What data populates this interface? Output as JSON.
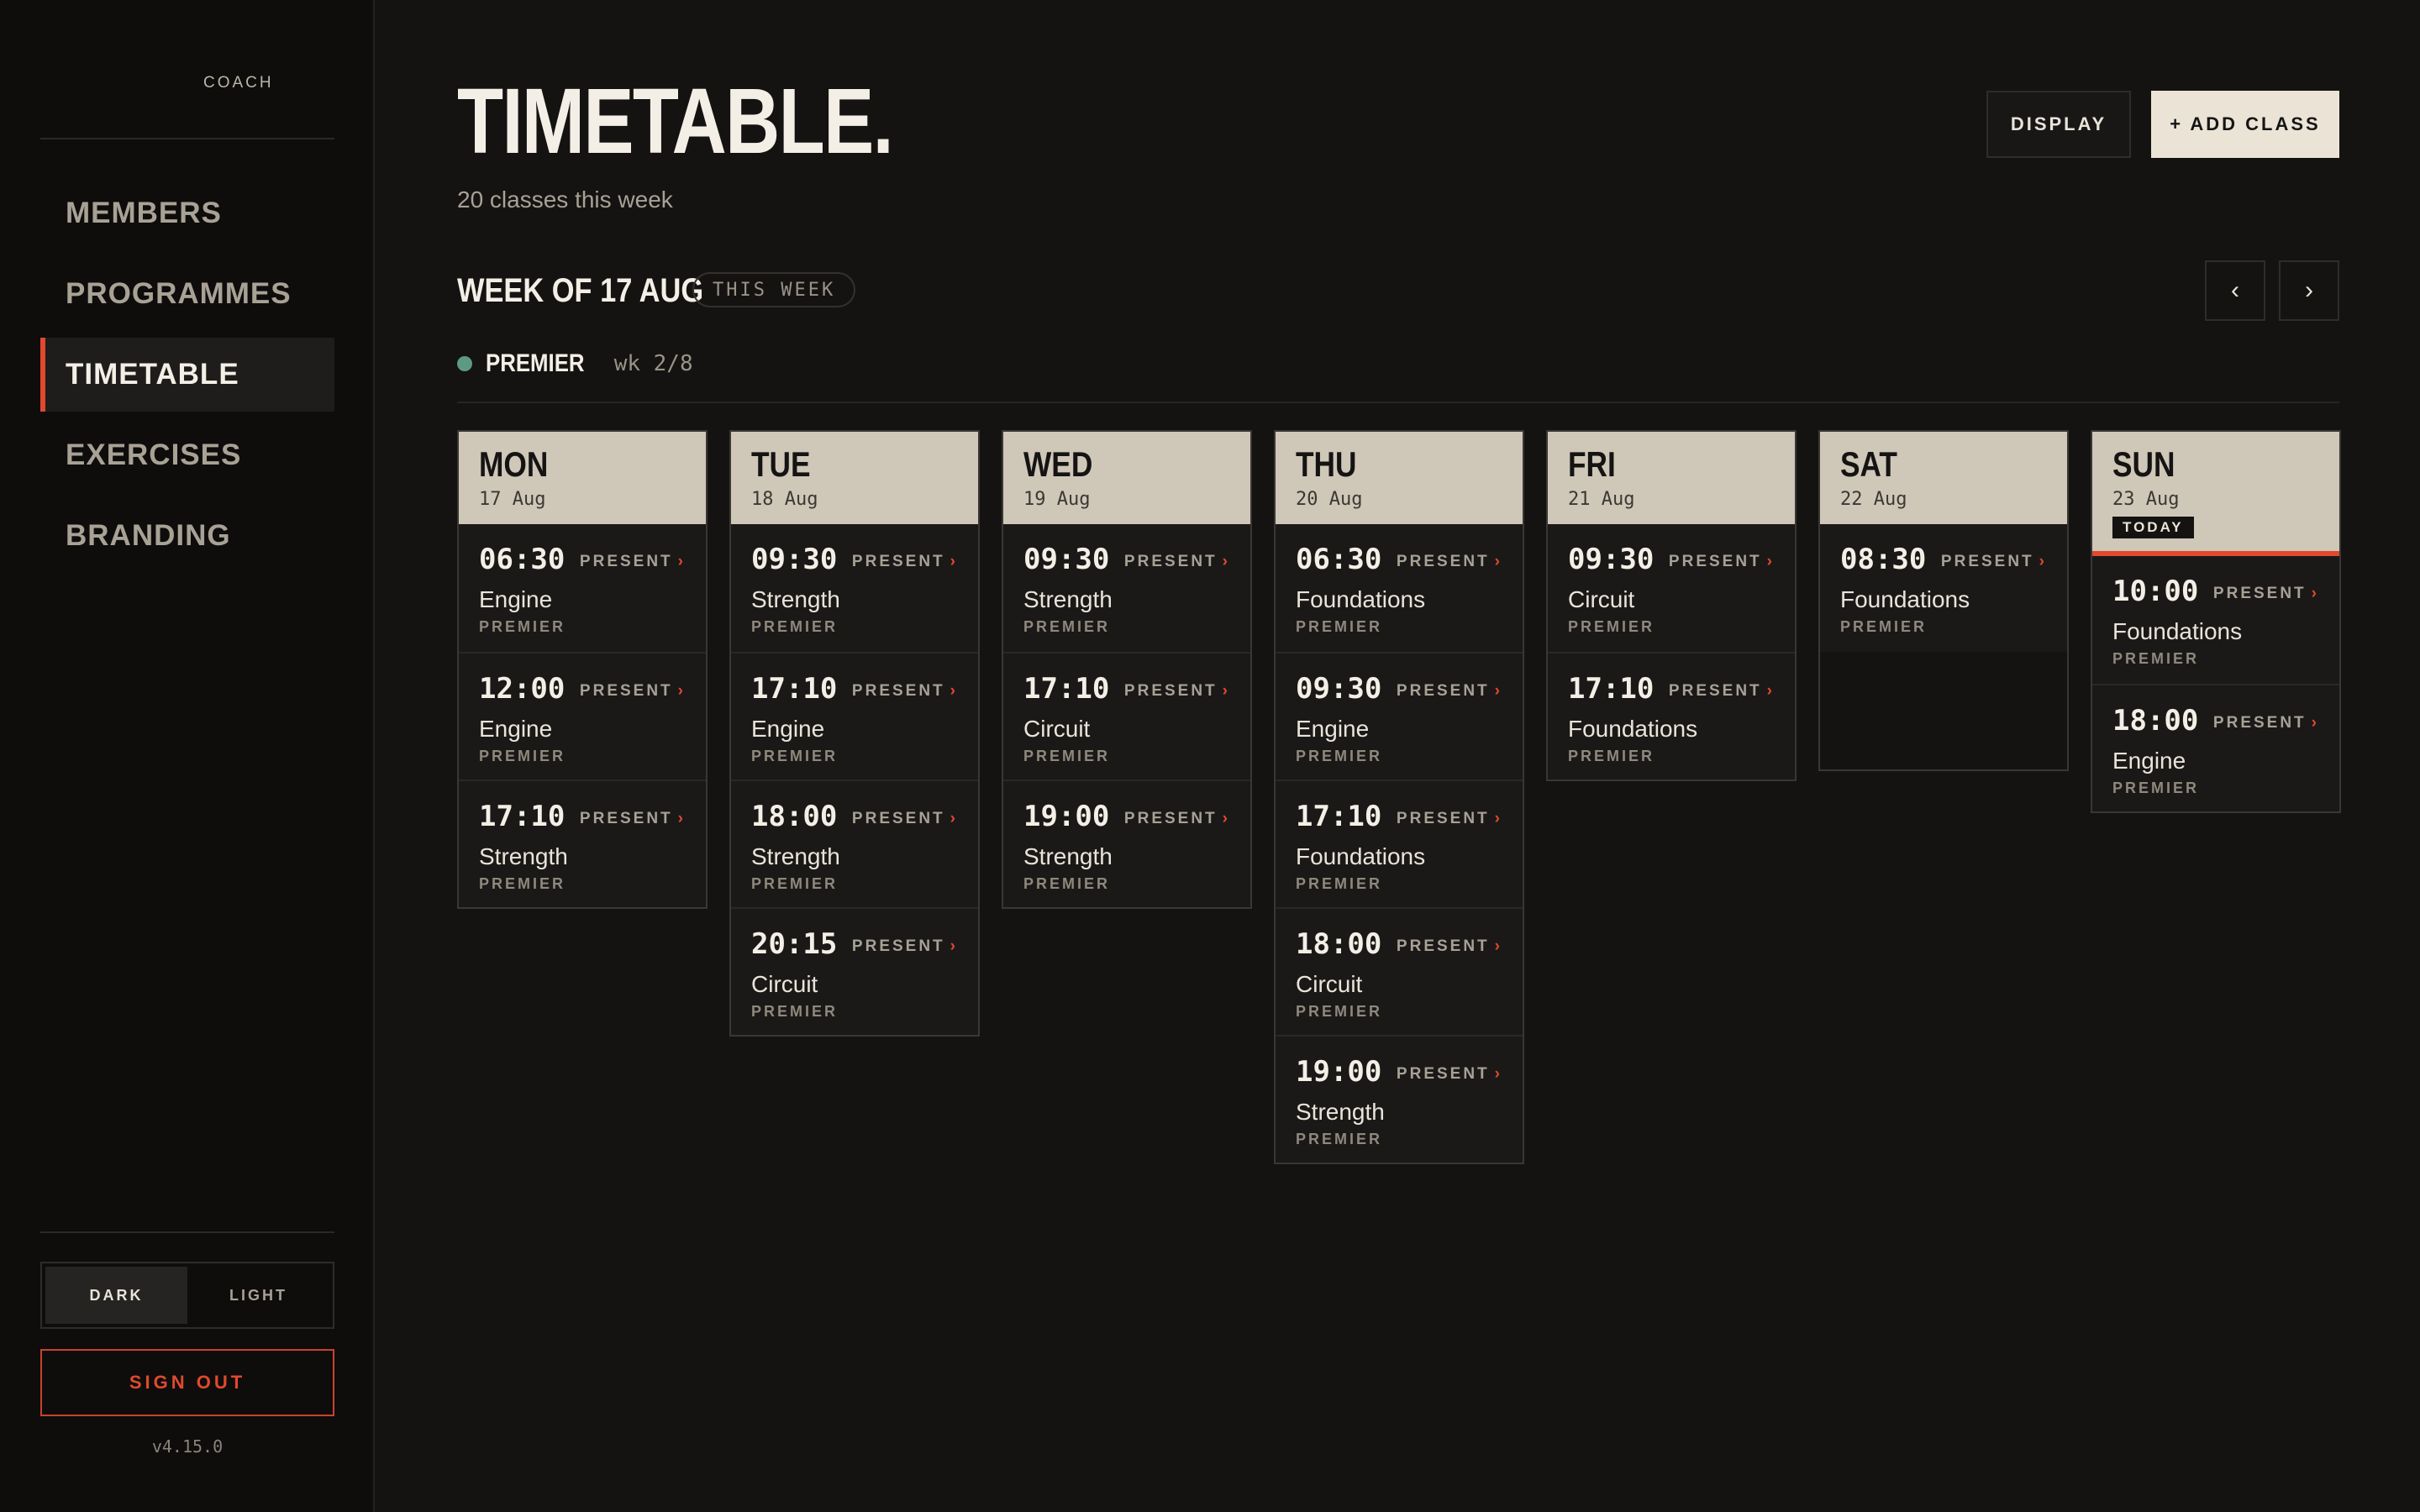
{
  "sidebar": {
    "brand": "COACH",
    "nav": [
      {
        "label": "MEMBERS",
        "active": false
      },
      {
        "label": "PROGRAMMES",
        "active": false
      },
      {
        "label": "TIMETABLE",
        "active": true
      },
      {
        "label": "EXERCISES",
        "active": false
      },
      {
        "label": "BRANDING",
        "active": false
      }
    ],
    "theme": {
      "dark": "DARK",
      "light": "LIGHT",
      "selected": "DARK"
    },
    "sign_out": "SIGN OUT",
    "version": "v4.15.0"
  },
  "header": {
    "title": "TIMETABLE.",
    "subtitle": "20 classes this week",
    "display_button": "DISPLAY",
    "add_class_button": "+ ADD CLASS"
  },
  "week": {
    "label": "WEEK OF 17 AUG",
    "badge": "THIS WEEK",
    "prev_glyph": "‹",
    "next_glyph": "›"
  },
  "programme": {
    "name": "PREMIER",
    "week": "wk 2/8",
    "color": "#5e9a82"
  },
  "colors": {
    "accent": "#e0492d",
    "day_header": "#cfc7b8",
    "background": "#141312"
  },
  "present_label": "PRESENT",
  "present_chevron": "›",
  "days": [
    {
      "name": "MON",
      "date": "17 Aug",
      "today": false,
      "classes": [
        {
          "time": "06:30",
          "name": "Engine",
          "programme": "PREMIER"
        },
        {
          "time": "12:00",
          "name": "Engine",
          "programme": "PREMIER"
        },
        {
          "time": "17:10",
          "name": "Strength",
          "programme": "PREMIER"
        }
      ]
    },
    {
      "name": "TUE",
      "date": "18 Aug",
      "today": false,
      "classes": [
        {
          "time": "09:30",
          "name": "Strength",
          "programme": "PREMIER"
        },
        {
          "time": "17:10",
          "name": "Engine",
          "programme": "PREMIER"
        },
        {
          "time": "18:00",
          "name": "Strength",
          "programme": "PREMIER"
        },
        {
          "time": "20:15",
          "name": "Circuit",
          "programme": "PREMIER"
        }
      ]
    },
    {
      "name": "WED",
      "date": "19 Aug",
      "today": false,
      "classes": [
        {
          "time": "09:30",
          "name": "Strength",
          "programme": "PREMIER"
        },
        {
          "time": "17:10",
          "name": "Circuit",
          "programme": "PREMIER"
        },
        {
          "time": "19:00",
          "name": "Strength",
          "programme": "PREMIER"
        }
      ]
    },
    {
      "name": "THU",
      "date": "20 Aug",
      "today": false,
      "classes": [
        {
          "time": "06:30",
          "name": "Foundations",
          "programme": "PREMIER"
        },
        {
          "time": "09:30",
          "name": "Engine",
          "programme": "PREMIER"
        },
        {
          "time": "17:10",
          "name": "Foundations",
          "programme": "PREMIER"
        },
        {
          "time": "18:00",
          "name": "Circuit",
          "programme": "PREMIER"
        },
        {
          "time": "19:00",
          "name": "Strength",
          "programme": "PREMIER"
        }
      ]
    },
    {
      "name": "FRI",
      "date": "21 Aug",
      "today": false,
      "classes": [
        {
          "time": "09:30",
          "name": "Circuit",
          "programme": "PREMIER"
        },
        {
          "time": "17:10",
          "name": "Foundations",
          "programme": "PREMIER"
        }
      ]
    },
    {
      "name": "SAT",
      "date": "22 Aug",
      "today": false,
      "classes": [
        {
          "time": "08:30",
          "name": "Foundations",
          "programme": "PREMIER"
        }
      ]
    },
    {
      "name": "SUN",
      "date": "23 Aug",
      "today": true,
      "today_label": "TODAY",
      "classes": [
        {
          "time": "10:00",
          "name": "Foundations",
          "programme": "PREMIER"
        },
        {
          "time": "18:00",
          "name": "Engine",
          "programme": "PREMIER"
        }
      ]
    }
  ]
}
